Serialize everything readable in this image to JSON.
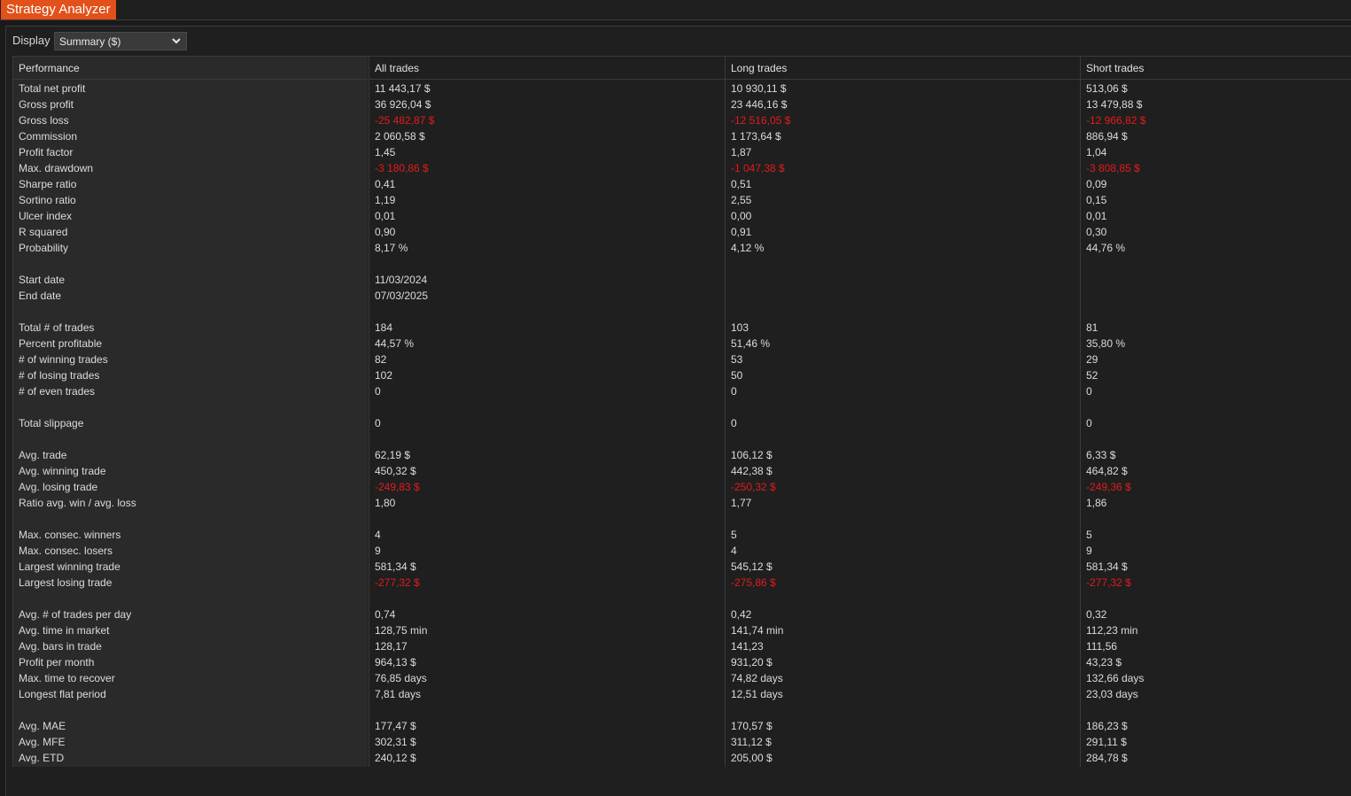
{
  "window": {
    "title": "Strategy Analyzer"
  },
  "display": {
    "label": "Display",
    "selected": "Summary ($)"
  },
  "colors": {
    "accent": "#e2511a",
    "negative": "#e41b1b",
    "background": "#1a1a1a",
    "label_column_bg": "#2a2a2a"
  },
  "table": {
    "headers": [
      "Performance",
      "All trades",
      "Long trades",
      "Short trades"
    ],
    "rows": [
      {
        "label": "Total net profit",
        "all": "11 443,17 $",
        "long": "10 930,11 $",
        "short": "513,06 $",
        "neg": false
      },
      {
        "label": "Gross profit",
        "all": "36 926,04 $",
        "long": "23 446,16 $",
        "short": "13 479,88 $",
        "neg": false
      },
      {
        "label": "Gross loss",
        "all": "-25 482,87 $",
        "long": "-12 516,05 $",
        "short": "-12 966,82 $",
        "neg": true
      },
      {
        "label": "Commission",
        "all": "2 060,58 $",
        "long": "1 173,64 $",
        "short": "886,94 $",
        "neg": false
      },
      {
        "label": "Profit factor",
        "all": "1,45",
        "long": "1,87",
        "short": "1,04",
        "neg": false
      },
      {
        "label": "Max. drawdown",
        "all": "-3 180,86 $",
        "long": "-1 047,38 $",
        "short": "-3 808,85 $",
        "neg": true
      },
      {
        "label": "Sharpe ratio",
        "all": "0,41",
        "long": "0,51",
        "short": "0,09",
        "neg": false
      },
      {
        "label": "Sortino ratio",
        "all": "1,19",
        "long": "2,55",
        "short": "0,15",
        "neg": false
      },
      {
        "label": "Ulcer index",
        "all": "0,01",
        "long": "0,00",
        "short": "0,01",
        "neg": false
      },
      {
        "label": "R squared",
        "all": "0,90",
        "long": "0,91",
        "short": "0,30",
        "neg": false
      },
      {
        "label": "Probability",
        "all": "8,17 %",
        "long": "4,12 %",
        "short": "44,76 %",
        "neg": false
      },
      null,
      {
        "label": "Start date",
        "all": "11/03/2024",
        "long": "",
        "short": "",
        "neg": false
      },
      {
        "label": "End date",
        "all": "07/03/2025",
        "long": "",
        "short": "",
        "neg": false
      },
      null,
      {
        "label": "Total # of trades",
        "all": "184",
        "long": "103",
        "short": "81",
        "neg": false
      },
      {
        "label": "Percent profitable",
        "all": "44,57 %",
        "long": "51,46 %",
        "short": "35,80 %",
        "neg": false
      },
      {
        "label": "# of winning trades",
        "all": "82",
        "long": "53",
        "short": "29",
        "neg": false
      },
      {
        "label": "# of losing trades",
        "all": "102",
        "long": "50",
        "short": "52",
        "neg": false
      },
      {
        "label": "# of even trades",
        "all": "0",
        "long": "0",
        "short": "0",
        "neg": false
      },
      null,
      {
        "label": "Total slippage",
        "all": "0",
        "long": "0",
        "short": "0",
        "neg": false
      },
      null,
      {
        "label": "Avg. trade",
        "all": "62,19 $",
        "long": "106,12 $",
        "short": "6,33 $",
        "neg": false
      },
      {
        "label": "Avg. winning trade",
        "all": "450,32 $",
        "long": "442,38 $",
        "short": "464,82 $",
        "neg": false
      },
      {
        "label": "Avg. losing trade",
        "all": "-249,83 $",
        "long": "-250,32 $",
        "short": "-249,36 $",
        "neg": true
      },
      {
        "label": "Ratio avg. win / avg. loss",
        "all": "1,80",
        "long": "1,77",
        "short": "1,86",
        "neg": false
      },
      null,
      {
        "label": "Max. consec. winners",
        "all": "4",
        "long": "5",
        "short": "5",
        "neg": false
      },
      {
        "label": "Max. consec. losers",
        "all": "9",
        "long": "4",
        "short": "9",
        "neg": false
      },
      {
        "label": "Largest winning trade",
        "all": "581,34 $",
        "long": "545,12 $",
        "short": "581,34 $",
        "neg": false
      },
      {
        "label": "Largest losing trade",
        "all": "-277,32 $",
        "long": "-275,86 $",
        "short": "-277,32 $",
        "neg": true
      },
      null,
      {
        "label": "Avg. # of trades per day",
        "all": "0,74",
        "long": "0,42",
        "short": "0,32",
        "neg": false
      },
      {
        "label": "Avg. time in market",
        "all": "128,75 min",
        "long": "141,74 min",
        "short": "112,23 min",
        "neg": false
      },
      {
        "label": "Avg. bars in trade",
        "all": "128,17",
        "long": "141,23",
        "short": "111,56",
        "neg": false
      },
      {
        "label": "Profit per month",
        "all": "964,13 $",
        "long": "931,20 $",
        "short": "43,23 $",
        "neg": false
      },
      {
        "label": "Max. time to recover",
        "all": "76,85 days",
        "long": "74,82 days",
        "short": "132,66 days",
        "neg": false
      },
      {
        "label": "Longest flat period",
        "all": "7,81 days",
        "long": "12,51 days",
        "short": "23,03 days",
        "neg": false
      },
      null,
      {
        "label": "Avg. MAE",
        "all": "177,47 $",
        "long": "170,57 $",
        "short": "186,23 $",
        "neg": false
      },
      {
        "label": "Avg. MFE",
        "all": "302,31 $",
        "long": "311,12 $",
        "short": "291,11 $",
        "neg": false
      },
      {
        "label": "Avg. ETD",
        "all": "240,12 $",
        "long": "205,00 $",
        "short": "284,78 $",
        "neg": false
      }
    ]
  }
}
